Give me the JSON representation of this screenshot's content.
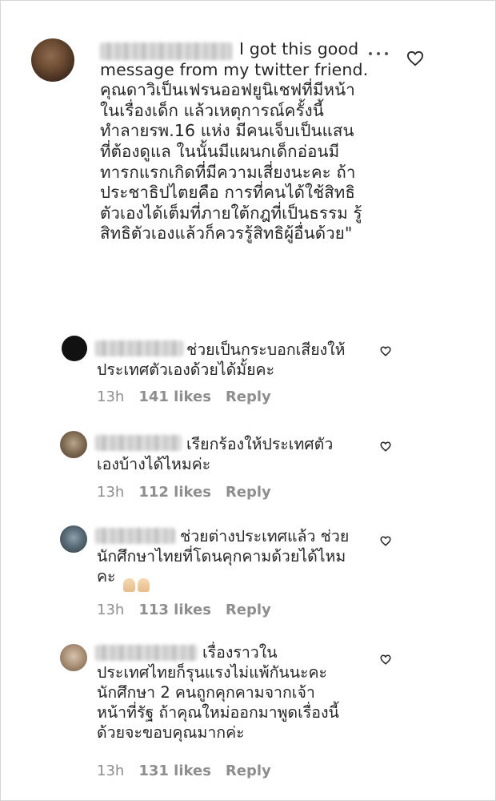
{
  "comments": [
    {
      "text": "I got this good\nmessage from my twitter friend.\nคุณดาวิเป็นเฟรนออฟยูนิเชฟที่มีหน้า\nในเรื่องเด็ก แล้วเหตุการณ์ครั้งนี้\nทำลายรพ.16 แห่ง มีคนเจ็บเป็นแสน\nที่ต้องดูแล ในนั้นมีแผนกเด็กอ่อนมี\nทารกแรกเกิดที่มีความเสี่ยงนะคะ ถ้า\nประชาธิปไตยคือ การที่คนได้ใช้สิทธิ\nตัวเองได้เต็มที่ภายใต้กฎที่เป็นธรรม รู้\nสิทธิตัวเองแล้วก็ควรรู้สิทธิผู้อื่นด้วย\""
    },
    {
      "text": "ช่วยเป็นกระบอกเสียงให้\nประเทศตัวเองด้วยได้มั้ยคะ",
      "time": "13h",
      "likes": "141 likes",
      "reply": "Reply"
    },
    {
      "text": "เรียกร้องให้ประเทศตัว\nเองบ้างได้ไหมค่ะ",
      "time": "13h",
      "likes": "112 likes",
      "reply": "Reply"
    },
    {
      "text": "ช่วยต่างประเทศแล้ว ช่วย\nนักศึกษาไทยที่โดนคุกคามด้วยได้ไหม\nคะ",
      "time": "13h",
      "likes": "113 likes",
      "reply": "Reply"
    },
    {
      "text": "เรื่องราวใน\nประเทศไทยก็รุนแรงไม่แพ้กันนะคะ\nนักศึกษา 2 คนถูกคุกคามจากเจ้า\nหน้าที่รัฐ ถ้าคุณใหม่ออกมาพูดเรื่องนี้\nด้วยจะขอบคุณมากค่ะ",
      "time": "13h",
      "likes": "131 likes",
      "reply": "Reply"
    }
  ],
  "icons": {
    "heart": "heart-outline-icon",
    "more": "more-horizontal-icon",
    "emoji": "folded-hands-emoji"
  },
  "colors": {
    "text": "#262626",
    "meta": "#8e8e8e",
    "heart": "#262626"
  }
}
